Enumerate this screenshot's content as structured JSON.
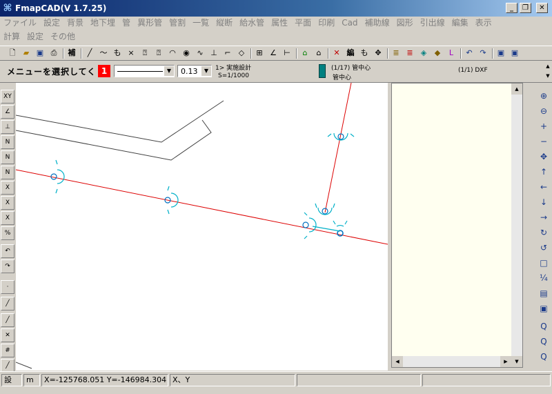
{
  "window": {
    "title": "FmapCAD(V 1.7.25)",
    "app_icon": "cad-app-icon",
    "buttons": {
      "minimize": "_",
      "maximize": "❐",
      "close": "✕"
    }
  },
  "menu": {
    "row1": [
      "ファイル",
      "設定",
      "背景",
      "地下埋",
      "管",
      "異形管",
      "管割",
      "一覧",
      "縦断",
      "給水管",
      "属性",
      "平面",
      "印刷",
      "Cad",
      "補助線",
      "図形",
      "引出線",
      "編集",
      "表示"
    ],
    "row2": [
      "計算",
      "設定",
      "その他"
    ]
  },
  "toolbar": {
    "hokan_label": "補",
    "edit_label": "編",
    "icons": [
      "new-file-icon",
      "open-folder-icon",
      "save-icon",
      "print-icon",
      "hokan-icon",
      "line-icon",
      "polyline-icon",
      "text-mo-icon",
      "cross-icon",
      "rect-help-icon",
      "circle-help-icon",
      "arc-help-icon",
      "eye-icon",
      "curve-icon",
      "perpendicular-icon",
      "help-line-icon",
      "tag-icon",
      "grid-dim-icon",
      "angle-icon",
      "measure-icon",
      "house-green-icon",
      "house-person-icon",
      "delete-x-icon",
      "edit-icon",
      "mo-help-icon",
      "move-arrows-icon",
      "layers-icon",
      "stack-icon",
      "paint-icon",
      "palette-icon",
      "l-shape-icon",
      "undo-icon",
      "redo-icon",
      "window-icon",
      "window-image-icon"
    ]
  },
  "status": {
    "prompt": "メニューを選択してく",
    "color_index": "1",
    "line_width": "0.13",
    "plan_title": "1> 実施設計",
    "scale": "S=1/1000",
    "layer_count": "(1/17) 管中心",
    "layer_name": "管中心",
    "dxf_count": "(1/1) DXF"
  },
  "left_tools": [
    {
      "icon": "xy-line-icon",
      "label": "XY"
    },
    {
      "icon": "angle-line-icon",
      "label": "∠"
    },
    {
      "icon": "t-offset-icon",
      "label": "⊥"
    },
    {
      "icon": "n-arrow-icon",
      "label": "N"
    },
    {
      "icon": "n-arrow2-icon",
      "label": "N"
    },
    {
      "icon": "n-arrow3-icon",
      "label": "N"
    },
    {
      "icon": "x-arrow-icon",
      "label": "X"
    },
    {
      "icon": "x-arrow2-icon",
      "label": "X"
    },
    {
      "icon": "x-arrow3-icon",
      "label": "X"
    },
    {
      "icon": "percent-icon",
      "label": "%"
    },
    {
      "icon": "undo-tool-icon",
      "label": "↶"
    },
    {
      "icon": "redo-tool-icon",
      "label": "↷"
    },
    {
      "icon": "point-icon",
      "label": "·"
    },
    {
      "icon": "segment-icon",
      "label": "╱"
    },
    {
      "icon": "node-icon",
      "label": "╱"
    },
    {
      "icon": "cross-tool-icon",
      "label": "✕"
    },
    {
      "icon": "grid-icon",
      "label": "#"
    },
    {
      "icon": "diagonal-icon",
      "label": "╱"
    }
  ],
  "right_tools": [
    {
      "icon": "zoom-window-icon",
      "label": "⊕"
    },
    {
      "icon": "zoom-all-icon",
      "label": "⊖"
    },
    {
      "icon": "zoom-in-icon",
      "label": "+"
    },
    {
      "icon": "zoom-out-icon",
      "label": "−"
    },
    {
      "icon": "pan-icon",
      "label": "✥"
    },
    {
      "icon": "arrow-up-icon",
      "label": "↑"
    },
    {
      "icon": "arrow-left-icon",
      "label": "←"
    },
    {
      "icon": "arrow-down-icon",
      "label": "↓"
    },
    {
      "icon": "arrow-right-icon",
      "label": "→"
    },
    {
      "icon": "redraw-icon",
      "label": "↻"
    },
    {
      "icon": "regen-icon",
      "label": "↺"
    },
    {
      "icon": "frame-icon",
      "label": "□"
    },
    {
      "icon": "scale-n-icon",
      "label": "¼"
    },
    {
      "icon": "sheet-icon",
      "label": "▤"
    },
    {
      "icon": "picture-icon",
      "label": "▣"
    },
    {
      "icon": "zoom-find-icon",
      "label": "Q"
    },
    {
      "icon": "zoom-find2-icon",
      "label": "Q"
    },
    {
      "icon": "zoom-find3-icon",
      "label": "Q"
    }
  ],
  "statusbar": {
    "mode": "設",
    "unit": "m",
    "coords": "X=-125768.051 Y=-146984.304",
    "axis": "X、Y",
    "field5": "",
    "field6": ""
  },
  "colors": {
    "pipe": "#dd0000",
    "fitting": "#00b0c8",
    "fitting_dark": "#0070c0",
    "road": "#404040",
    "panel_bg": "#fffff0",
    "title_start": "#0a246a"
  }
}
